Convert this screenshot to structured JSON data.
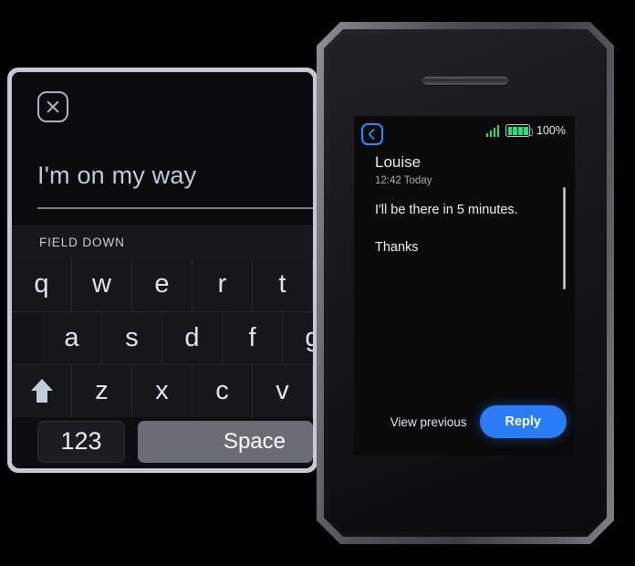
{
  "left_device": {
    "name": "compose-keyboard-device",
    "close_icon": "close-x-icon",
    "compose": {
      "text": "I'm on my way"
    },
    "field_strip": {
      "label": "FIELD DOWN"
    },
    "keyboard": {
      "row1": [
        "q",
        "w",
        "e",
        "r",
        "t"
      ],
      "row2": [
        "a",
        "s",
        "d",
        "f",
        "g"
      ],
      "row3_shift_icon": "shift-arrow-up-icon",
      "row3": [
        "z",
        "x",
        "c",
        "v"
      ],
      "numeric_key": "123",
      "space_key": "Space"
    }
  },
  "phone": {
    "name": "message-preview-phone",
    "status_bar": {
      "back_icon": "chevron-left-icon",
      "signal_icon": "signal-bars-icon",
      "battery_icon": "battery-full-icon",
      "battery_percent": "100%"
    },
    "message": {
      "sender": "Louise",
      "timestamp": "12:42 Today",
      "lines": [
        "I'll be there in 5 minutes.",
        "Thanks"
      ]
    },
    "actions": {
      "view_previous": "View previous",
      "reply": "Reply"
    }
  },
  "colors": {
    "accent_blue": "#2a7cf7",
    "status_green": "#23e07a",
    "device_bezel": "#c8c7d4",
    "screen_black": "#0a0a0b"
  }
}
